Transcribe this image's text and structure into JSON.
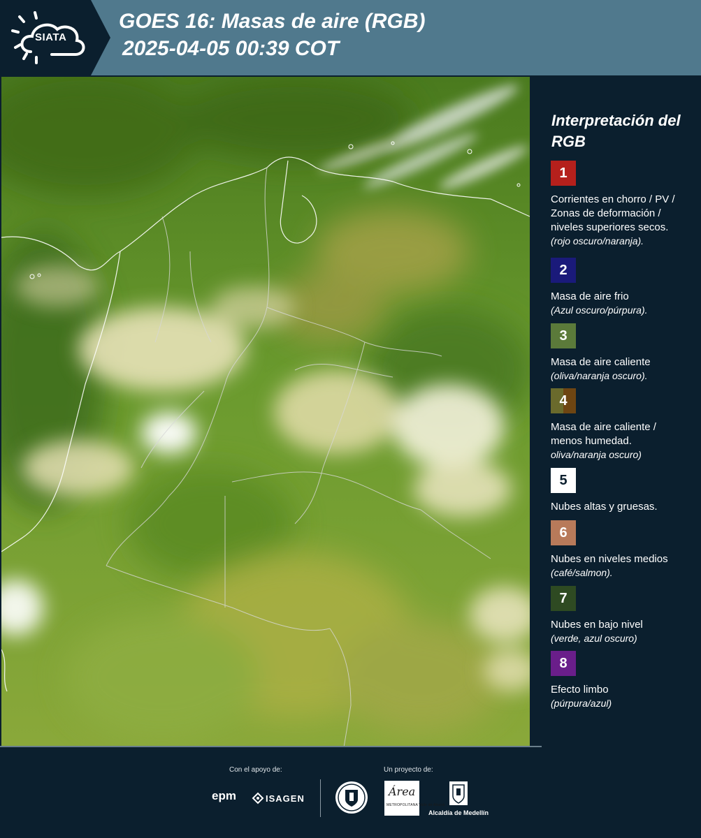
{
  "header": {
    "logo_text": "SIATA",
    "title_line1": "GOES 16: Masas de aire (RGB)",
    "title_line2": "2025-04-05 00:39 COT"
  },
  "legend": {
    "title": "Interpretación del RGB",
    "items": [
      {
        "number": "1",
        "color": "#b5201c",
        "text": "Corrientes en chorro / PV / Zonas de deformación / niveles superiores secos.",
        "sub": "(rojo oscuro/naranja)."
      },
      {
        "number": "2",
        "color": "#1a1a7a",
        "text": "Masa de aire frio",
        "sub": "(Azul oscuro/púrpura)."
      },
      {
        "number": "3",
        "color": "#5b7a3a",
        "text": "Masa de aire caliente",
        "sub": "(oliva/naranja oscuro)."
      },
      {
        "number": "4",
        "colors": [
          "#6a6a2c",
          "#6e4512"
        ],
        "text": "Masa de aire caliente / menos humedad.",
        "sub": "oliva/naranja oscuro)"
      },
      {
        "number": "5",
        "color": "#ffffff",
        "text": "Nubes altas y gruesas.",
        "sub": ""
      },
      {
        "number": "6",
        "color": "#b87a5a",
        "text": "Nubes en niveles medios",
        "sub": "(café/salmon)."
      },
      {
        "number": "7",
        "color": "#2e4a22",
        "text": "Nubes en bajo nivel",
        "sub": "(verde, azul oscuro)"
      },
      {
        "number": "8",
        "color": "#6a1e8a",
        "text": "Efecto limbo",
        "sub": "(púrpura/azul)"
      }
    ]
  },
  "footer": {
    "support_label": "Con el apoyo de:",
    "project_label": "Un proyecto de:",
    "epm": "epm",
    "isagen": "ISAGEN",
    "area_logo": "Área",
    "area_small": "METROPOLITANA Valle de Aburrá",
    "alcaldia": "Alcaldía de Medellín"
  },
  "colors": {
    "header_bg": "#50798d",
    "panel_bg": "#0b1f2e",
    "map_green": "#5e8a2c"
  }
}
